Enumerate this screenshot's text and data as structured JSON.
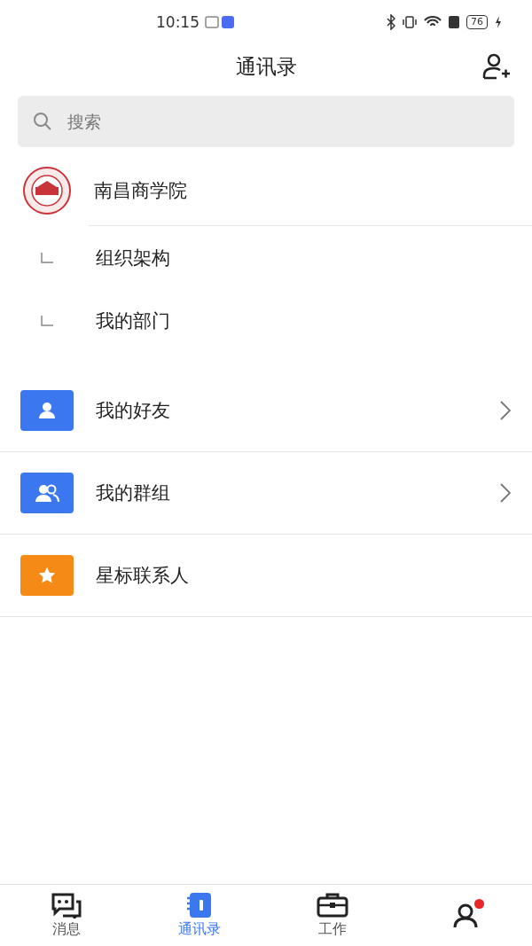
{
  "status_bar": {
    "time": "10:15",
    "battery": "76"
  },
  "header": {
    "title": "通讯录"
  },
  "search": {
    "placeholder": "搜索"
  },
  "organization": {
    "name": "南昌商学院",
    "children": [
      {
        "label": "组织架构"
      },
      {
        "label": "我的部门"
      }
    ]
  },
  "entries": [
    {
      "label": "我的好友",
      "kind": "person",
      "color": "#3b78f0",
      "chevron": true
    },
    {
      "label": "我的群组",
      "kind": "group",
      "color": "#3b78f0",
      "chevron": true
    },
    {
      "label": "星标联系人",
      "kind": "star",
      "color": "#f58a16",
      "chevron": false
    }
  ],
  "tabs": [
    {
      "label": "消息",
      "kind": "chat",
      "selected": false
    },
    {
      "label": "通讯录",
      "kind": "contacts",
      "selected": true
    },
    {
      "label": "工作",
      "kind": "work",
      "selected": false
    },
    {
      "kind": "profile",
      "selected": false,
      "badge": true
    }
  ]
}
